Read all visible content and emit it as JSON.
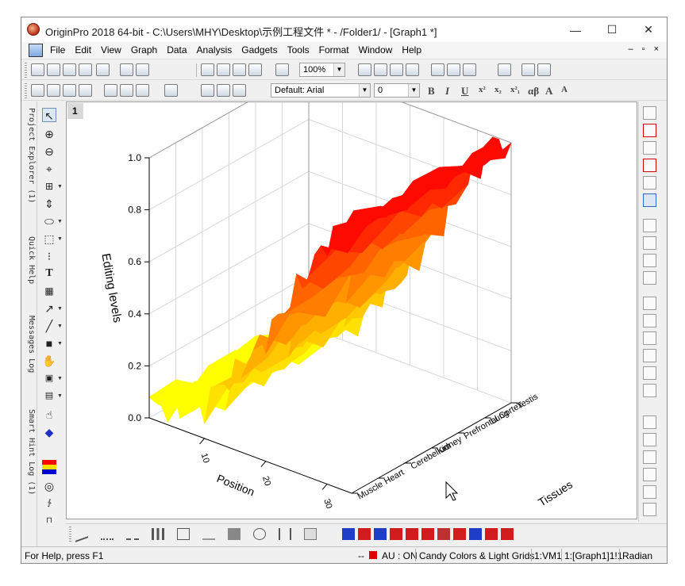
{
  "window": {
    "title": "OriginPro 2018 64-bit - C:\\Users\\MHY\\Desktop\\示例工程文件 * - /Folder1/ - [Graph1 *]",
    "controls": {
      "minimize": "—",
      "maximize": "☐",
      "close": "✕"
    }
  },
  "menu": {
    "items": [
      "File",
      "Edit",
      "View",
      "Graph",
      "Data",
      "Analysis",
      "Gadgets",
      "Tools",
      "Format",
      "Window",
      "Help"
    ],
    "mdi_controls": "– ▫ ×"
  },
  "toolbar": {
    "zoom_value": "100%",
    "font_name": "Default: Arial",
    "font_size": "0",
    "format_buttons": [
      "B",
      "I",
      "U",
      "x²",
      "x₂",
      "x²₁",
      "αβ",
      "A",
      "A"
    ]
  },
  "side_panel": {
    "tabs": [
      "Project Explorer (1)",
      "Quick Help",
      "Messages Log",
      "Smart Hint Log (1)"
    ]
  },
  "graph": {
    "layer_index": "1",
    "icons": {
      "left_tools": [
        "pointer-icon",
        "zoom-in-icon",
        "zoom-out-icon",
        "data-reader-icon",
        "scale-icon",
        "screen-reader-icon",
        "rotate-icon",
        "region-icon",
        "data-selector-icon",
        "text-tool-icon",
        "annotation-icon",
        "arrow-tool-icon",
        "line-tool-icon",
        "rectangle-tool-icon",
        "hand-tool-icon",
        "color-scale-icon",
        "regional-mask-icon"
      ]
    }
  },
  "chart_data": {
    "type": "surface",
    "title": "",
    "xlabel": "Position",
    "ylabel": "Tissues",
    "zlabel": "Editing levels",
    "x_ticks": [
      "10",
      "20",
      "30"
    ],
    "y_categories": [
      "Muscle",
      "Heart",
      "Cerebellum",
      "Kidney",
      "Prefrontal Cortex",
      "Lung",
      "Testis"
    ],
    "z_ticks": [
      "0.0",
      "0.2",
      "0.4",
      "0.6",
      "0.8",
      "1.0"
    ],
    "zlim": [
      0,
      1.0
    ],
    "color_map": "Candy Colors",
    "colormap_colors": [
      "#ffff00",
      "#ffe100",
      "#ffc800",
      "#ffaf00",
      "#ff9600",
      "#ff7d00",
      "#ff6400",
      "#ff4600",
      "#ff2800",
      "#ff0a00"
    ],
    "grid": true,
    "edge_profile": [
      {
        "position": 1,
        "level": 0.05
      },
      {
        "position": 9,
        "level": 0.09
      },
      {
        "position": 13,
        "level": 0.25
      },
      {
        "position": 15,
        "level": 0.28
      },
      {
        "position": 21,
        "level": 0.52
      },
      {
        "position": 28,
        "level": 0.84
      },
      {
        "position": 31,
        "level": 0.98
      },
      {
        "position": 34,
        "level": 1.0
      }
    ],
    "surface_rows": 7,
    "surface_cols": 34
  },
  "status": {
    "help": "For Help, press F1",
    "separator": "--",
    "au": "AU : ON",
    "theme": "Candy Colors & Light Grids",
    "view": "1:VM1",
    "page": "1:[Graph1]1!1",
    "angle_unit": "Radian"
  }
}
